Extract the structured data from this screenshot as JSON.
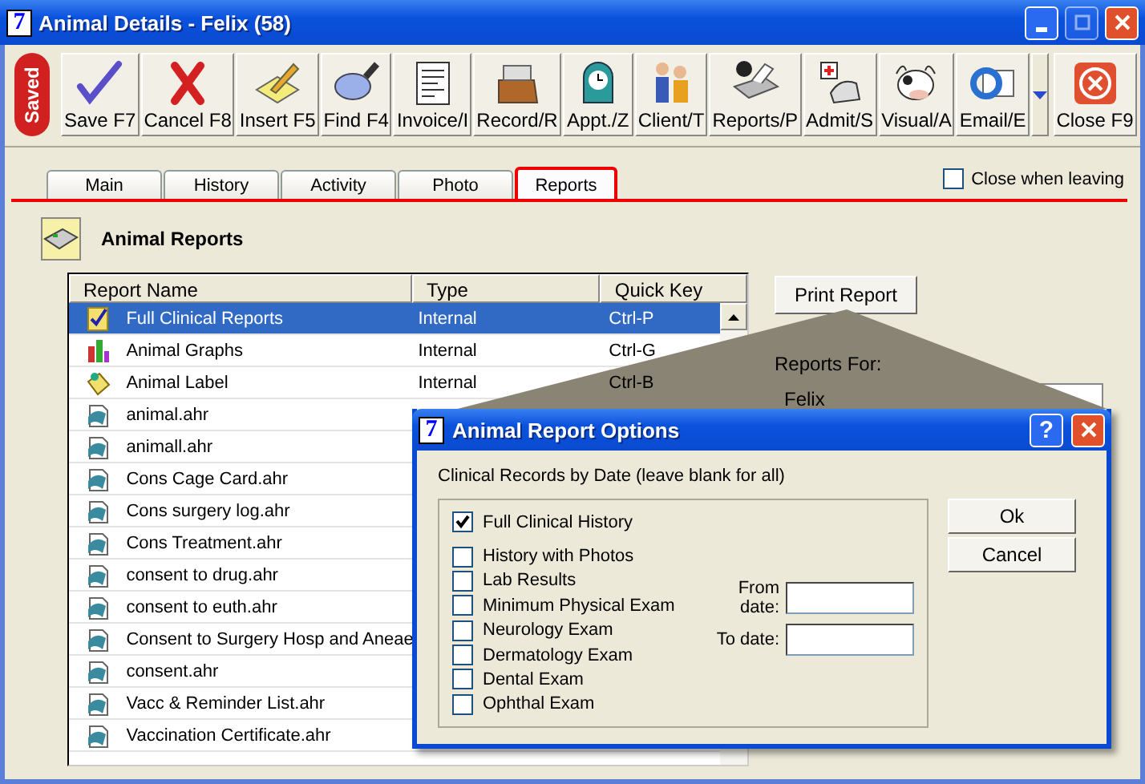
{
  "window": {
    "app_icon": "7",
    "title": "Animal Details - Felix (58)"
  },
  "toolbar": {
    "saved_badge": "Saved",
    "buttons": [
      {
        "label": "Save F7"
      },
      {
        "label": "Cancel F8"
      },
      {
        "label": "Insert F5"
      },
      {
        "label": "Find F4"
      },
      {
        "label": "Invoice/I"
      },
      {
        "label": "Record/R"
      },
      {
        "label": "Appt./Z"
      },
      {
        "label": "Client/T"
      },
      {
        "label": "Reports/P"
      },
      {
        "label": "Admit/S"
      },
      {
        "label": "Visual/A"
      },
      {
        "label": "Email/E"
      },
      {
        "label": "Close F9"
      }
    ]
  },
  "tabs": [
    {
      "label": "Main",
      "selected": false
    },
    {
      "label": "History",
      "selected": false
    },
    {
      "label": "Activity",
      "selected": false
    },
    {
      "label": "Photo",
      "selected": false
    },
    {
      "label": "Reports",
      "selected": true
    }
  ],
  "close_when_leaving": {
    "label": "Close when leaving",
    "checked": false
  },
  "section_title": "Animal Reports",
  "table": {
    "columns": [
      "Report Name",
      "Type",
      "Quick Key"
    ],
    "rows": [
      {
        "kind": "checklist",
        "name": "Full Clinical Reports",
        "type": "Internal",
        "quick_key": "Ctrl-P",
        "selected": true
      },
      {
        "kind": "chart",
        "name": "Animal Graphs",
        "type": "Internal",
        "quick_key": "Ctrl-G",
        "selected": false
      },
      {
        "kind": "label",
        "name": "Animal Label",
        "type": "Internal",
        "quick_key": "Ctrl-B",
        "selected": false
      },
      {
        "kind": "file",
        "name": "animal.ahr",
        "selected": false
      },
      {
        "kind": "file",
        "name": "animall.ahr",
        "selected": false
      },
      {
        "kind": "file",
        "name": "Cons Cage Card.ahr",
        "selected": false
      },
      {
        "kind": "file",
        "name": "Cons surgery log.ahr",
        "selected": false
      },
      {
        "kind": "file",
        "name": "Cons Treatment.ahr",
        "selected": false
      },
      {
        "kind": "file",
        "name": "consent to drug.ahr",
        "selected": false
      },
      {
        "kind": "file",
        "name": "consent to euth.ahr",
        "selected": false
      },
      {
        "kind": "file",
        "name": "Consent to Surgery Hosp and Aneae",
        "selected": false
      },
      {
        "kind": "file",
        "name": "consent.ahr",
        "selected": false
      },
      {
        "kind": "file",
        "name": "Vacc & Reminder List.ahr",
        "selected": false
      },
      {
        "kind": "file",
        "name": "Vaccination Certificate.ahr",
        "selected": false
      }
    ]
  },
  "print_button": "Print Report",
  "reports_for": {
    "label": "Reports For:",
    "items": [
      "Felix"
    ]
  },
  "dialog": {
    "app_icon": "7",
    "title": "Animal Report Options",
    "help_button": "?",
    "subtitle": "Clinical Records by Date (leave blank for all)",
    "options": [
      {
        "label": "Full Clinical History",
        "checked": true
      },
      {
        "label": "History with Photos",
        "checked": false
      },
      {
        "label": "Lab Results",
        "checked": false
      },
      {
        "label": "Minimum Physical Exam",
        "checked": false
      },
      {
        "label": "Neurology Exam",
        "checked": false
      },
      {
        "label": "Dermatology Exam",
        "checked": false
      },
      {
        "label": "Dental Exam",
        "checked": false
      },
      {
        "label": "Ophthal Exam",
        "checked": false
      }
    ],
    "from_date": {
      "label": "From date:"
    },
    "to_date": {
      "label": "To date:"
    },
    "buttons": [
      "Ok",
      "Cancel"
    ]
  }
}
